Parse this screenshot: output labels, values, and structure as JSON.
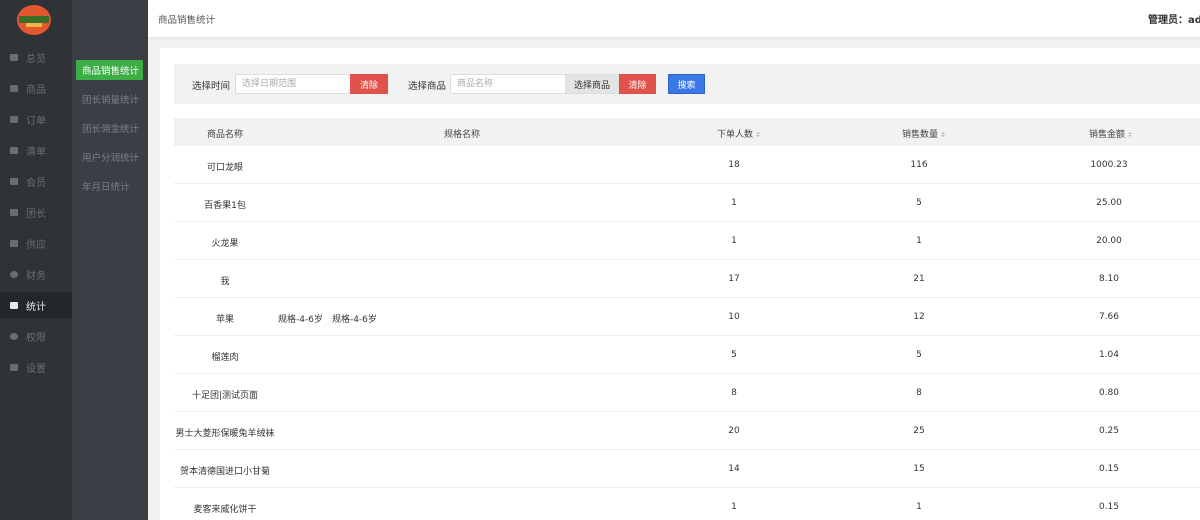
{
  "header": {
    "breadcrumb": "商品销售统计",
    "admin_label": "管理员：adm"
  },
  "colors": {
    "sidebar_bg": "#2f3237",
    "subnav_bg": "#3b3f45",
    "active_green": "#3cae45",
    "danger_red": "#e0524a",
    "primary_blue": "#3b78e7"
  },
  "nav_primary": [
    {
      "label": "总览",
      "icon": "grid-icon"
    },
    {
      "label": "商品",
      "icon": "box-icon"
    },
    {
      "label": "订单",
      "icon": "order-icon"
    },
    {
      "label": "清单",
      "icon": "list-icon"
    },
    {
      "label": "会员",
      "icon": "user-icon"
    },
    {
      "label": "团长",
      "icon": "leader-icon"
    },
    {
      "label": "供应",
      "icon": "supply-icon"
    },
    {
      "label": "财务",
      "icon": "money-icon"
    },
    {
      "label": "统计",
      "icon": "chart-icon",
      "active": true
    },
    {
      "label": "权限",
      "icon": "shield-icon"
    },
    {
      "label": "设置",
      "icon": "lock-icon"
    }
  ],
  "nav_secondary": [
    {
      "label": "商品销售统计",
      "active": true
    },
    {
      "label": "团长销量统计"
    },
    {
      "label": "团长佣金统计"
    },
    {
      "label": "用户分润统计"
    },
    {
      "label": "年月日统计"
    }
  ],
  "filters": {
    "time_label": "选择时间",
    "date_placeholder": "选择日期范围",
    "clear_label": "清除",
    "product_label": "选择商品",
    "product_placeholder": "商品名称",
    "select_product_label": "选择商品",
    "clear2_label": "清除",
    "search_label": "搜索"
  },
  "table": {
    "columns": {
      "name": "商品名称",
      "spec": "规格名称",
      "orders": "下单人数",
      "qty": "销售数量",
      "amount": "销售金额"
    },
    "rows": [
      {
        "name": "可口龙眼",
        "spec": "",
        "orders": "18",
        "qty": "116",
        "amount": "1000.23"
      },
      {
        "name": "百香果1包",
        "spec": "",
        "orders": "1",
        "qty": "5",
        "amount": "25.00"
      },
      {
        "name": "火龙果",
        "spec": "",
        "orders": "1",
        "qty": "1",
        "amount": "20.00"
      },
      {
        "name": "我",
        "spec": "",
        "orders": "17",
        "qty": "21",
        "amount": "8.10"
      },
      {
        "name": "苹果",
        "spec": "规格-4-6岁　规格-4-6岁",
        "orders": "10",
        "qty": "12",
        "amount": "7.66"
      },
      {
        "name": "榴莲肉",
        "spec": "",
        "orders": "5",
        "qty": "5",
        "amount": "1.04"
      },
      {
        "name": "十足团|测试页面",
        "spec": "",
        "orders": "8",
        "qty": "8",
        "amount": "0.80"
      },
      {
        "name": "男士大菱形保暖兔羊绒袜",
        "spec": "",
        "orders": "20",
        "qty": "25",
        "amount": "0.25"
      },
      {
        "name": "贺本清德国进口小甘菊",
        "spec": "",
        "orders": "14",
        "qty": "15",
        "amount": "0.15"
      },
      {
        "name": "麦客来威化饼干",
        "spec": "",
        "orders": "1",
        "qty": "1",
        "amount": "0.15"
      }
    ]
  }
}
